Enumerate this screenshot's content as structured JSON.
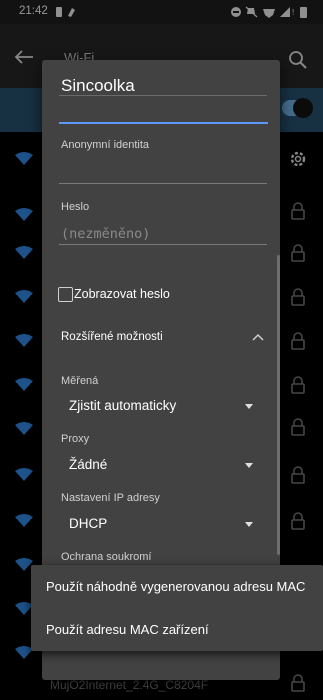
{
  "status_bar": {
    "time": "21:42"
  },
  "background": {
    "title": "Wi-Fi",
    "bottom_network": "MujO2Internet_2.4G_C8204F"
  },
  "dialog": {
    "title": "Sincoolka",
    "anon_identity_label": "Anonymní identita",
    "password_label": "Heslo",
    "password_placeholder": "(nezměněno)",
    "show_password_label": "Zobrazovat heslo",
    "advanced_label": "Rozšířené možnosti",
    "metered_label": "Měřená",
    "metered_value": "Zjistit automaticky",
    "proxy_label": "Proxy",
    "proxy_value": "Žádné",
    "ip_label": "Nastavení IP adresy",
    "ip_value": "DHCP",
    "privacy_label": "Ochrana soukromí"
  },
  "popup_menu": {
    "items": [
      {
        "label": "Použít náhodně vygenerovanou adresu MAC"
      },
      {
        "label": "Použít adresu MAC zařízení"
      }
    ]
  },
  "colors": {
    "accent": "#5e97f6",
    "dialog_bg": "#424242",
    "toggle_on": "#6aa6d6"
  },
  "icons": [
    "back-arrow-icon",
    "search-icon",
    "wifi-icon",
    "lock-icon",
    "gear-icon",
    "chevron-up-icon",
    "caret-down-icon"
  ]
}
